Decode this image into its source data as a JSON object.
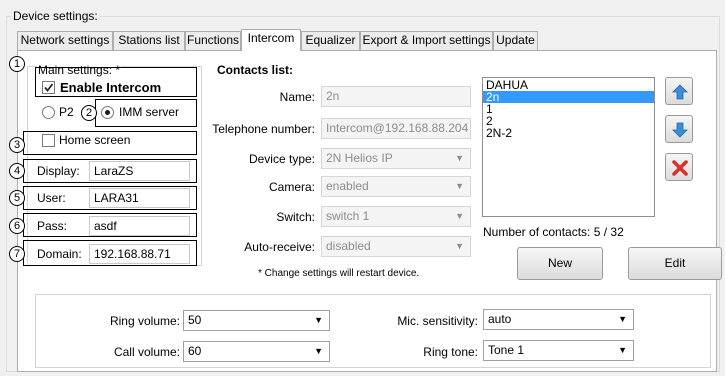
{
  "group_title": "Device settings:",
  "tabs": [
    {
      "label": "Network settings"
    },
    {
      "label": "Stations list"
    },
    {
      "label": "Functions"
    },
    {
      "label": "Intercom"
    },
    {
      "label": "Equalizer"
    },
    {
      "label": "Export & Import settings"
    },
    {
      "label": "Update"
    }
  ],
  "main_settings": {
    "title": "Main settings: *",
    "enable_intercom": "Enable Intercom",
    "p2p": "P2",
    "imm_server": "IMM server",
    "home_screen": "Home screen",
    "display_label": "Display:",
    "display_value": "LaraZS",
    "user_label": "User:",
    "user_value": "LARA31",
    "pass_label": "Pass:",
    "pass_value": "asdf",
    "domain_label": "Domain:",
    "domain_value": "192.168.88.71"
  },
  "markers": [
    "1",
    "2",
    "3",
    "4",
    "5",
    "6",
    "7"
  ],
  "contacts": {
    "title": "Contacts list:",
    "name_label": "Name:",
    "name_value": "2n",
    "phone_label": "Telephone number:",
    "phone_value": "Intercom@192.168.88.204",
    "device_type_label": "Device type:",
    "device_type_value": "2N Helios IP",
    "camera_label": "Camera:",
    "camera_value": "enabled",
    "switch_label": "Switch:",
    "switch_value": "switch 1",
    "auto_receive_label": "Auto-receive:",
    "auto_receive_value": "disabled",
    "restart_note": "* Change settings will restart device.",
    "list": [
      "DAHUA",
      "2n",
      "1",
      "2",
      "2N-2"
    ],
    "selected_index": 1,
    "count_text": "Number of contacts: 5 / 32",
    "new_label": "New",
    "edit_label": "Edit"
  },
  "icons": {
    "up": "arrow-up-icon",
    "down": "arrow-down-icon",
    "delete": "delete-x-icon"
  },
  "audio": {
    "ring_volume_label": "Ring volume:",
    "ring_volume_value": "50",
    "call_volume_label": "Call volume:",
    "call_volume_value": "60",
    "mic_label": "Mic. sensitivity:",
    "mic_value": "auto",
    "ring_tone_label": "Ring tone:",
    "ring_tone_value": "Tone 1"
  },
  "colors": {
    "selection": "#3399ff",
    "arrow_blue": "#3b8fd9",
    "delete_red": "#d9302a"
  }
}
